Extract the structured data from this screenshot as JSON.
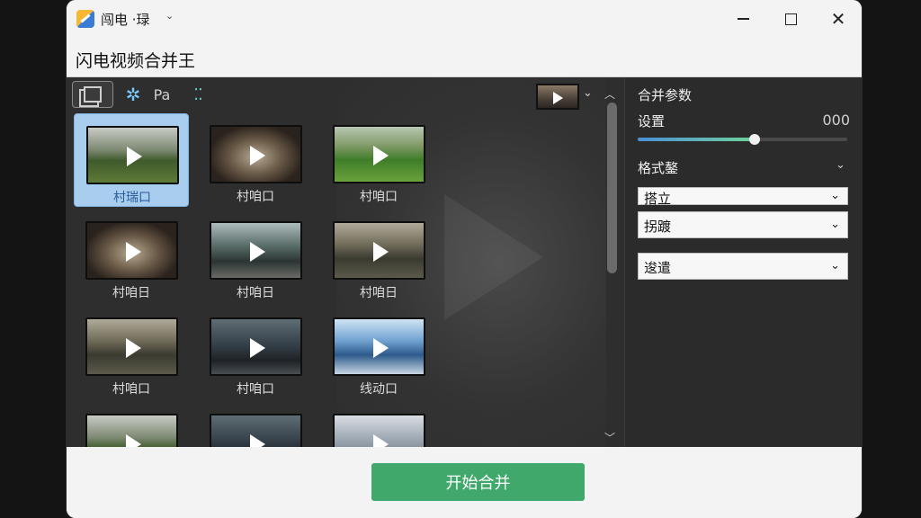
{
  "titlebar": {
    "app_name": "闯电 ·琭",
    "caret": "⌄"
  },
  "header": {
    "title": "闪电视频合并王"
  },
  "toolbar": {
    "star_icon": "✲",
    "text_label": "Pa",
    "dots_icon": "⁚⁚",
    "preview_caret": "⌄"
  },
  "grid": {
    "tiles": [
      {
        "label": "村瑞口",
        "scene": "forest",
        "selected": true
      },
      {
        "label": "村咱口",
        "scene": "cave",
        "selected": false
      },
      {
        "label": "村咱口",
        "scene": "grass",
        "selected": false
      },
      {
        "label": "村咱日",
        "scene": "cave",
        "selected": false
      },
      {
        "label": "村咱日",
        "scene": "rail",
        "selected": false
      },
      {
        "label": "村咱日",
        "scene": "road",
        "selected": false
      },
      {
        "label": "村咱口",
        "scene": "road",
        "selected": false
      },
      {
        "label": "村咱口",
        "scene": "dark",
        "selected": false
      },
      {
        "label": "线动口",
        "scene": "mount",
        "selected": false
      },
      {
        "label": "",
        "scene": "forest",
        "selected": false
      },
      {
        "label": "",
        "scene": "dark",
        "selected": false
      },
      {
        "label": "",
        "scene": "city",
        "selected": false
      }
    ]
  },
  "panel": {
    "title": "合并参数",
    "setting_label": "设置",
    "setting_value": "000",
    "slider_level": 0.56,
    "section_label": "格式鏊",
    "section_caret": "⌄",
    "selects": [
      {
        "value": "搭立",
        "caret": "⌄"
      },
      {
        "value": "拐踱",
        "caret": "⌄"
      },
      {
        "value": "逡遣",
        "caret": "⌄"
      }
    ]
  },
  "footer": {
    "start_label": "开始合并"
  },
  "colors": {
    "accent_green": "#3fa86a",
    "selected_tile": "#a9cdee",
    "slider_start": "#4a8fd8",
    "slider_end": "#6fd39a"
  }
}
